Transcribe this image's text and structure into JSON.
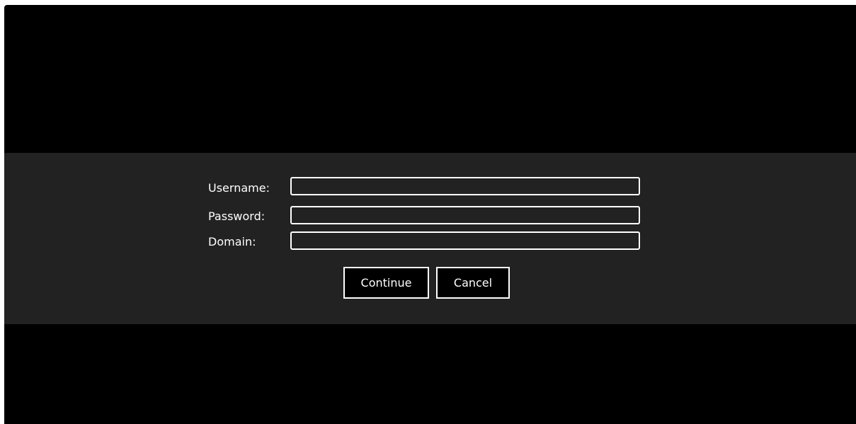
{
  "login": {
    "username_label": "Username:",
    "password_label": "Password:",
    "domain_label": "Domain:",
    "username_value": "",
    "password_value": "",
    "domain_value": "",
    "continue_label": "Continue",
    "cancel_label": "Cancel"
  },
  "colors": {
    "page_background": "#000000",
    "form_band": "#222222",
    "text": "#ffffff",
    "field_border": "#ffffff"
  }
}
